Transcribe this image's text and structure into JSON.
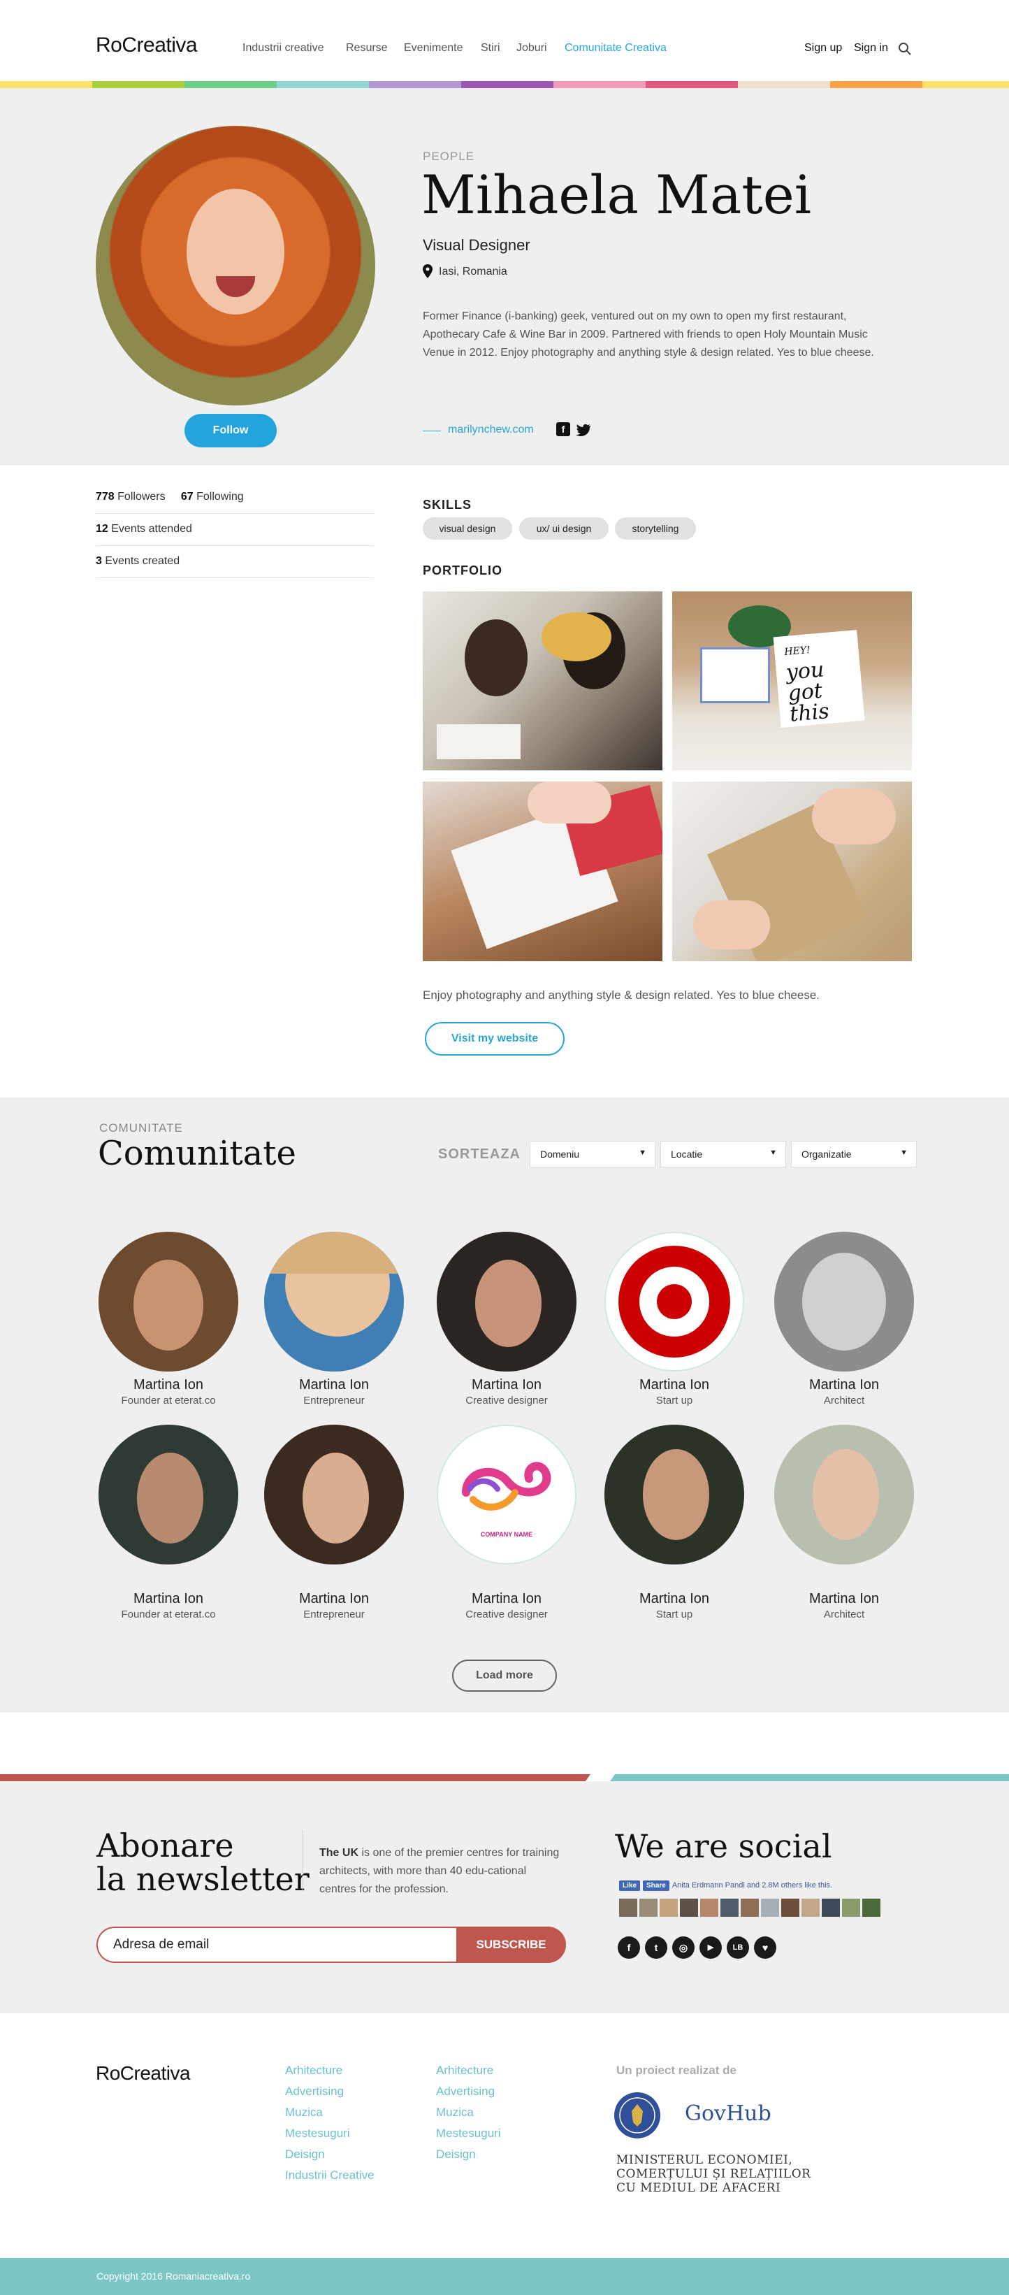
{
  "header": {
    "logo": "RoCreativa",
    "nav": [
      {
        "label": "Industrii creative",
        "active": false
      },
      {
        "label": "Resurse",
        "active": false
      },
      {
        "label": "Evenimente",
        "active": false
      },
      {
        "label": "Stiri",
        "active": false
      },
      {
        "label": "Joburi",
        "active": false
      },
      {
        "label": "Comunitate Creativa",
        "active": true
      }
    ],
    "sign_up": "Sign up",
    "sign_in": "Sign in",
    "search_icon": "search-icon",
    "color_stripes": [
      "#fce26a",
      "#a9cf3a",
      "#6bcf8a",
      "#8fd5d3",
      "#b695d3",
      "#9b55b3",
      "#f09ab8",
      "#e1577f",
      "#efe0cc",
      "#f7a246"
    ]
  },
  "profile": {
    "kicker": "PEOPLE",
    "name": "Mihaela Matei",
    "title": "Visual Designer",
    "location": "Iasi, Romania",
    "bio": "Former Finance (i-banking) geek, ventured out on my own to open my first restaurant, Apothecary Cafe & Wine Bar in 2009. Partnered with friends to open Holy Mountain Music Venue in 2012. Enjoy photography and anything style & design related. Yes to blue cheese.",
    "website": "marilynchew.com",
    "follow_label": "Follow",
    "facebook_icon": "f",
    "twitter_icon": "t"
  },
  "stats": {
    "followers_count": "778",
    "followers_label": "Followers",
    "following_count": "67",
    "following_label": "Following",
    "events_attended_count": "12",
    "events_attended_label": "Events attended",
    "events_created_count": "3",
    "events_created_label": "Events created"
  },
  "skills": {
    "heading": "SKILLS",
    "items": [
      "visual design",
      "ux/ ui design",
      "storytelling"
    ]
  },
  "portfolio": {
    "heading": "PORTFOLIO",
    "card_text": [
      "HEY!",
      "you",
      "got",
      "this"
    ],
    "caption": "Enjoy photography and anything style & design related. Yes to blue cheese.",
    "visit_label": "Visit my website"
  },
  "community": {
    "kicker": "COMUNITATE",
    "title": "Comunitate",
    "sort_label": "SORTEAZA",
    "filters": [
      "Domeniu",
      "Locatie",
      "Organizatie"
    ],
    "members": [
      {
        "name": "Martina Ion",
        "role": "Founder at eterat.co",
        "bg": "#6e4a2e",
        "skin": "#c89373"
      },
      {
        "name": "Martina Ion",
        "role": "Entrepreneur",
        "bg": "#3f7fb6",
        "skin": "#e9c39e"
      },
      {
        "name": "Martina Ion",
        "role": "Creative designer",
        "bg": "#2a2422",
        "skin": "#c89479"
      },
      {
        "name": "Martina Ion",
        "role": "Start up",
        "bg": "#ffffff",
        "skin": "#cc0000"
      },
      {
        "name": "Martina Ion",
        "role": "Architect",
        "bg": "#8c8c8c",
        "skin": "#d0d0d0"
      },
      {
        "name": "Martina Ion",
        "role": "Founder at eterat.co",
        "bg": "#2f3a34",
        "skin": "#b88a70"
      },
      {
        "name": "Martina Ion",
        "role": "Entrepreneur",
        "bg": "#3b2a20",
        "skin": "#d9ad90"
      },
      {
        "name": "Martina Ion",
        "role": "Creative designer",
        "bg": "#ffffff",
        "skin": "#e03b8c"
      },
      {
        "name": "Martina Ion",
        "role": "Start up",
        "bg": "#2b3329",
        "skin": "#c7997a"
      },
      {
        "name": "Martina Ion",
        "role": "Architect",
        "bg": "#b9bfae",
        "skin": "#e4c0a8"
      }
    ],
    "logo_caption": "COMPANY NAME",
    "load_more": "Load more"
  },
  "newsletter": {
    "title_line1": "Abonare",
    "title_line2": "la newsletter",
    "text_bold": "The UK",
    "text_rest": " is one of the premier centres for training architects, with more than 40 edu-cational centres for the profession.",
    "input_placeholder": "Adresa de email",
    "subscribe_label": "SUBSCRIBE",
    "social_title": "We are social",
    "fb_like": "Like",
    "fb_share": "Share",
    "fb_text": "Anita Erdmann Pandl and 2.8M others like this.",
    "social_icons": [
      {
        "icon": "facebook-icon",
        "glyph": "f"
      },
      {
        "icon": "twitter-icon",
        "glyph": "t"
      },
      {
        "icon": "instagram-icon",
        "glyph": "◎"
      },
      {
        "icon": "youtube-icon",
        "glyph": "▶"
      },
      {
        "icon": "lb-icon",
        "glyph": "LB"
      },
      {
        "icon": "heart-icon",
        "glyph": "♥"
      }
    ]
  },
  "footer": {
    "logo": "RoCreativa",
    "col1": [
      "Arhitecture",
      "Advertising",
      "Muzica",
      "Mestesuguri",
      "Deisign",
      "Industrii Creative"
    ],
    "col2": [
      "Arhitecture",
      "Advertising",
      "Muzica",
      "Mestesuguri",
      "Deisign"
    ],
    "project_heading": "Un proiect realizat de",
    "gov_hub": "GovHub",
    "ministry_lines": [
      "MINISTERUL ECONOMIEI,",
      "COMERȚULUI ȘI RELAȚIILOR",
      "CU MEDIUL DE AFACERI"
    ],
    "copyright": "Copyright 2016 Romaniacreativa.ro"
  }
}
